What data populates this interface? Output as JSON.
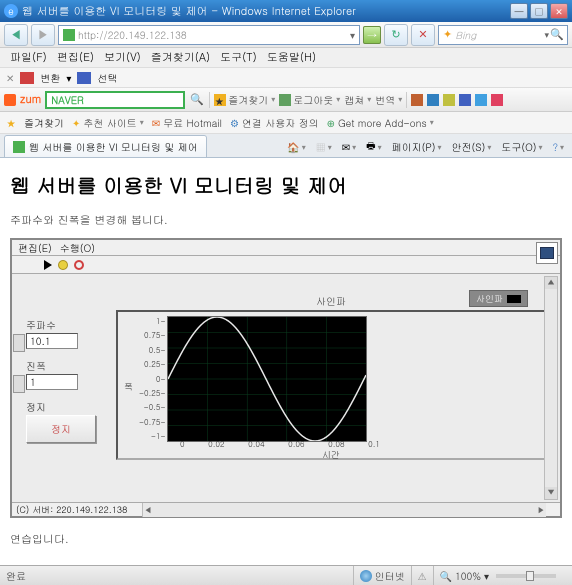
{
  "window": {
    "title": "웹 서버를 이용한 VI 모니터링 및 제어 - Windows Internet Explorer"
  },
  "nav": {
    "url": "http://220.149.122.138",
    "search_placeholder": "Bing"
  },
  "menubar": {
    "file": "파일(F)",
    "edit": "편집(E)",
    "view": "보기(V)",
    "favorites": "즐겨찾기(A)",
    "tools": "도구(T)",
    "help": "도움말(H)"
  },
  "tb2": {
    "convert": "변환",
    "select": "선택"
  },
  "tb3": {
    "zum": "zum",
    "naver": "NAVER",
    "fav": "즐겨찾기",
    "logout": "로그아웃",
    "capture": "캡쳐",
    "translate": "번역"
  },
  "favbar": {
    "label": "즐겨찾기",
    "rec_sites": "추천 사이트",
    "hotmail": "무료 Hotmail",
    "conn_settings": "연결 사용자 정의",
    "addons": "Get more Add-ons"
  },
  "tab": {
    "title": "웹 서버를 이용한 VI 모니터링 및 제어"
  },
  "tabright": {
    "home": "",
    "page": "페이지(P)",
    "safety": "안전(S)",
    "tools": "도구(O)"
  },
  "page": {
    "h1": "웹 서버를 이용한 VI 모니터링 및 제어",
    "sub": "주파수와 진폭을 변경해 봅니다.",
    "footer": "연습입니다."
  },
  "panel": {
    "menu_edit": "편집(E)",
    "menu_op": "수행(O)",
    "freq_label": "주파수",
    "freq_value": "10.1",
    "amp_label": "진폭",
    "amp_value": "1",
    "stop_label": "정지",
    "stop_btn": "정지",
    "status": "(C) 서버: 220.149.122.138"
  },
  "chart_data": {
    "type": "line",
    "title": "사인파",
    "legend": "사인파",
    "xlabel": "시간",
    "ylabel": "폭",
    "xticks": [
      "0",
      "0.02",
      "0.04",
      "0.06",
      "0.08",
      "0.1"
    ],
    "yticks": [
      "1-",
      "0.75-",
      "0.5-",
      "0.25-",
      "0-",
      "-0.25-",
      "-0.5-",
      "-0.75-",
      "-1-"
    ],
    "xlim": [
      0,
      0.1
    ],
    "ylim": [
      -1,
      1
    ],
    "series": [
      {
        "name": "사인파",
        "frequency_hz": 10.1,
        "amplitude": 1
      }
    ]
  },
  "status": {
    "done": "완료",
    "zone": "인터넷",
    "zoom": "100%"
  }
}
